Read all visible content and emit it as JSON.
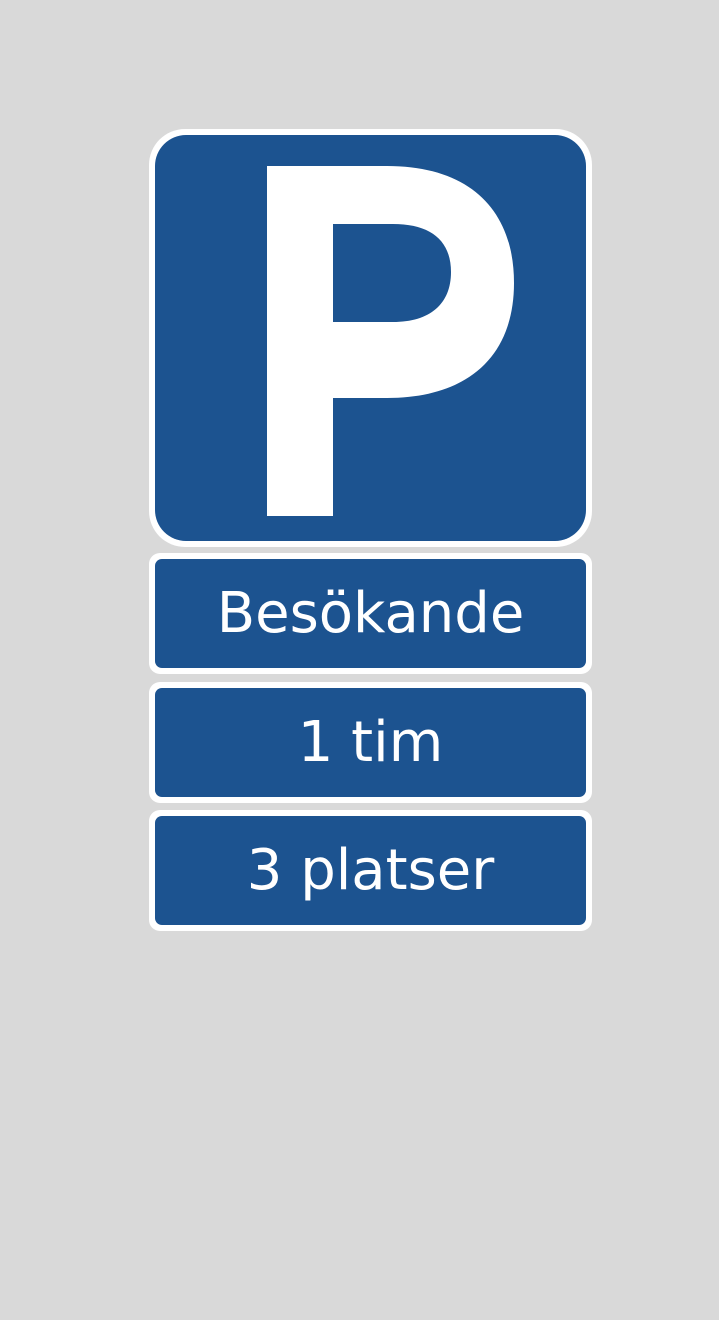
{
  "sign": {
    "symbol": "P",
    "plates": [
      {
        "text": "Besökande"
      },
      {
        "text": "1 tim"
      },
      {
        "text": "3 platser"
      }
    ]
  },
  "colors": {
    "background": "#d9d9d9",
    "sign_blue": "#1c5390",
    "border_white": "#ffffff"
  }
}
